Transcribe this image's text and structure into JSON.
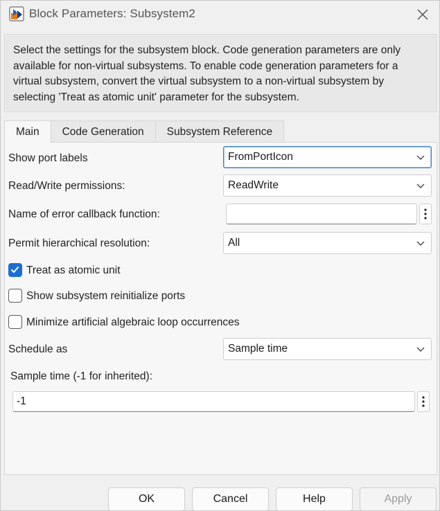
{
  "window": {
    "title": "Block Parameters: Subsystem2"
  },
  "description": "Select the settings for the subsystem block. Code generation parameters are only available for non-virtual subsystems. To enable code generation parameters for a virtual subsystem, convert the virtual subsystem to a non-virtual subsystem by selecting 'Treat as atomic unit' parameter for the subsystem.",
  "tabs": [
    {
      "label": "Main",
      "active": true
    },
    {
      "label": "Code Generation",
      "active": false
    },
    {
      "label": "Subsystem Reference",
      "active": false
    }
  ],
  "main": {
    "show_port_labels": {
      "label": "Show port labels",
      "value": "FromPortIcon"
    },
    "rw_permissions": {
      "label": "Read/Write permissions:",
      "value": "ReadWrite"
    },
    "error_callback": {
      "label": "Name of error callback function:",
      "value": ""
    },
    "hierarchical_resolution": {
      "label": "Permit hierarchical resolution:",
      "value": "All"
    },
    "treat_atomic": {
      "label": "Treat as atomic unit",
      "checked": true
    },
    "show_reinit_ports": {
      "label": "Show subsystem reinitialize ports",
      "checked": false
    },
    "minimize_loops": {
      "label": "Minimize artificial algebraic loop occurrences",
      "checked": false
    },
    "schedule_as": {
      "label": "Schedule as",
      "value": "Sample time"
    },
    "sample_time": {
      "label": "Sample time (-1 for inherited):",
      "value": "-1"
    }
  },
  "buttons": {
    "ok": "OK",
    "cancel": "Cancel",
    "help": "Help",
    "apply": "Apply"
  },
  "colors": {
    "accent": "#1c6ed6",
    "focus_border": "#3c7fd1"
  },
  "icons": {
    "app": "simulink-block-icon",
    "close": "close-icon",
    "dropdown": "chevron-down-icon",
    "more": "vertical-ellipsis-icon",
    "check": "checkmark-icon"
  }
}
